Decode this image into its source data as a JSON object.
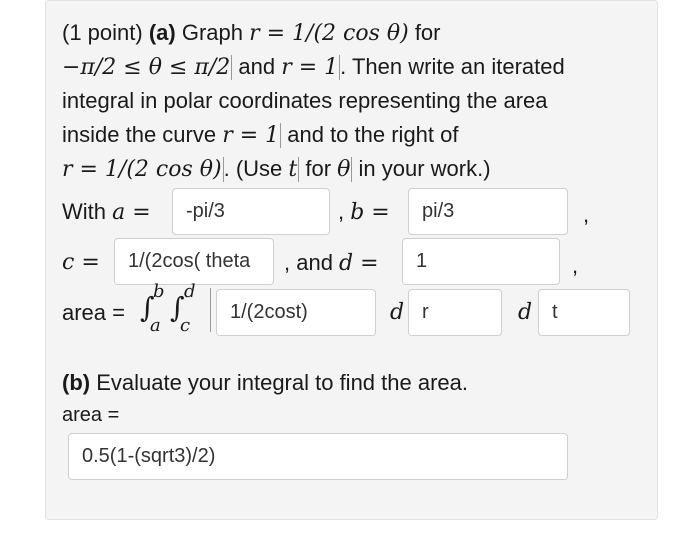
{
  "part_a": {
    "prefix": "(1 point) ",
    "label": "(a)",
    "graph_word": " Graph ",
    "r_eq_1_over_2costheta": "r = 1/(2 cos θ)",
    "for_word": " for",
    "theta_range": "−π/2 ≤ θ ≤ π/2",
    "and_word": " and ",
    "r_eq_1": "r = 1",
    "then_text": ". Then write an iterated",
    "line3": "integral in polar coordinates representing the area",
    "line4_a": "inside the curve ",
    "line4_b": " and to the right of",
    "line5_text": ". (Use ",
    "t_var": "t",
    "for_word2": " for ",
    "theta": "θ",
    "line5_end": " in your work.)"
  },
  "with_label": "With ",
  "a_eq": "a =",
  "a_value": "-pi/3",
  "comma_b": ", ",
  "b_eq": "b =",
  "b_value": "pi/3",
  "comma": ",",
  "c_eq": "c =",
  "c_value": "1/(2cos( theta",
  "and_d": ", and ",
  "d_eq": "d =",
  "d_value": "1",
  "area_label": "area = ",
  "integral_outer": "∫",
  "lower_a": "a",
  "upper_b": "b",
  "integral_inner": "∫",
  "lower_c": "c",
  "upper_d": "d",
  "integrand_value": "1/(2cost)",
  "d_symbol": "d",
  "inner_var_value": "r",
  "d_symbol2": "d",
  "outer_var_value": "t",
  "part_b": {
    "label": "(b)",
    "text": " Evaluate your integral to find the area."
  },
  "area_b_label": "area =",
  "area_b_value": "0.5(1-(sqrt3)/2)"
}
